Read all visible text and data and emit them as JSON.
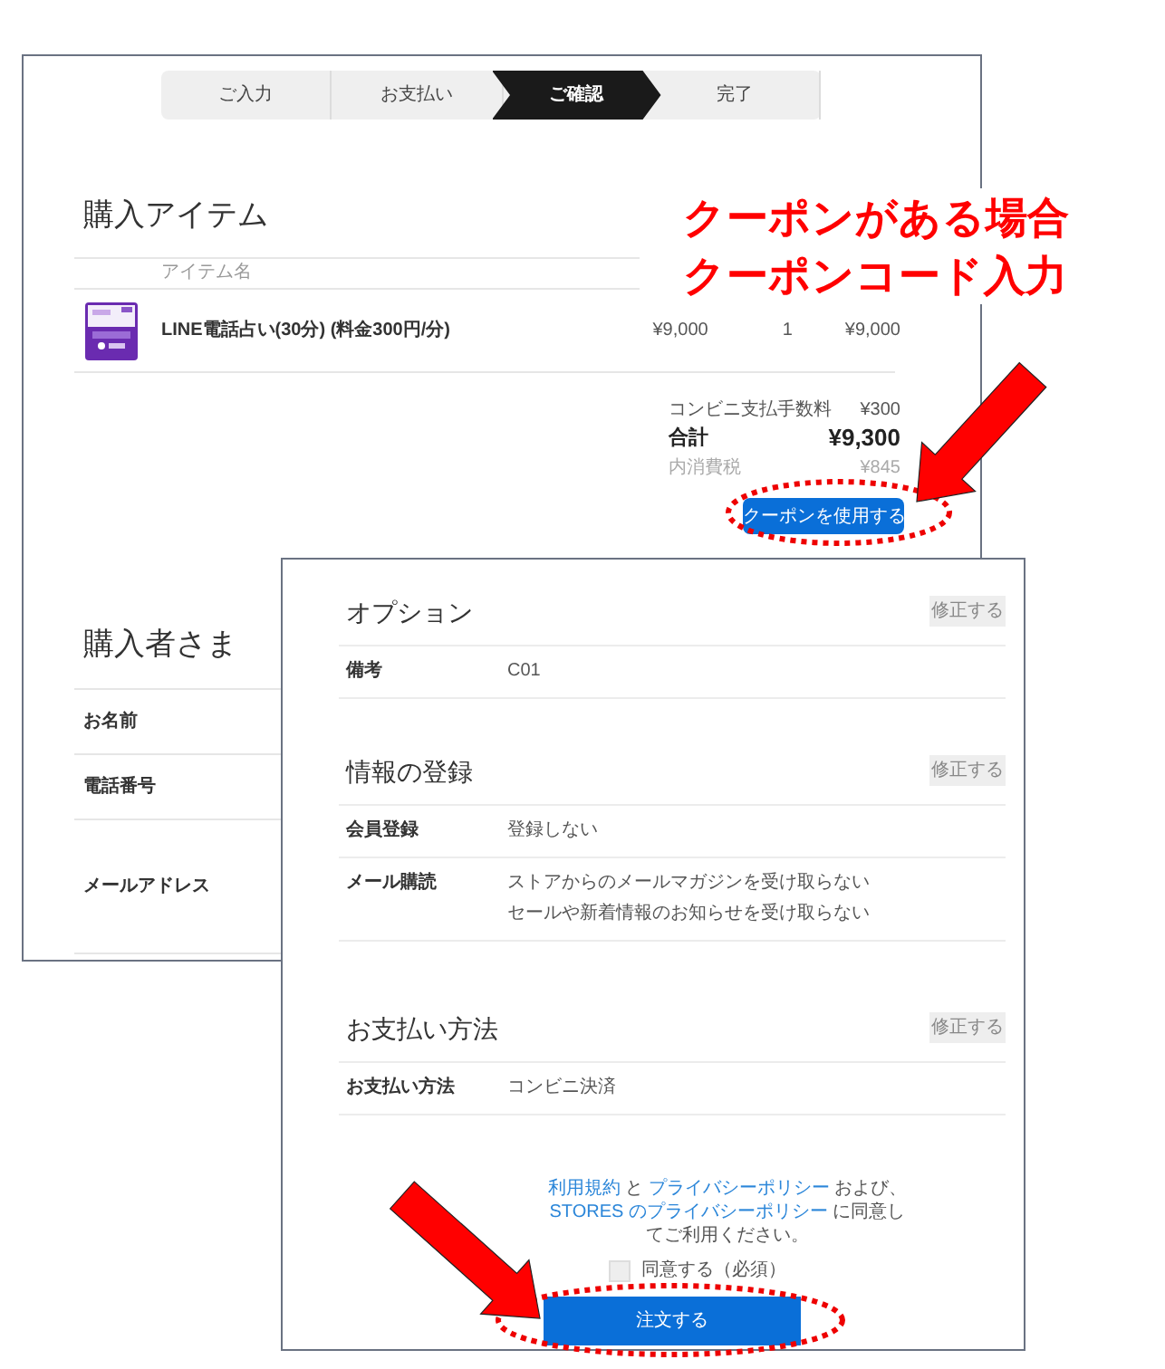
{
  "back_page": {
    "steps": [
      {
        "label": "ご入力",
        "selected": false
      },
      {
        "label": "お支払い",
        "selected": false
      },
      {
        "label": "ご確認",
        "selected": true
      },
      {
        "label": "完了",
        "selected": false
      }
    ],
    "items_section": {
      "title": "購入アイテム",
      "column": "アイテム名",
      "items": [
        {
          "name": "LINE電話占い(30分) (料金300円/分)",
          "price": "¥9,000",
          "quantity": "1",
          "total": "¥9,000"
        }
      ]
    },
    "summary": [
      {
        "kind": "fee",
        "label": "コンビニ支払手数料",
        "value": "¥300"
      },
      {
        "kind": "total",
        "label": "合計",
        "value": "¥9,300"
      },
      {
        "kind": "tax",
        "label": "内消費税",
        "value": "¥845"
      }
    ],
    "coupon_button": "クーポンを使用する",
    "buyer_section": {
      "title": "購入者さま",
      "rows": [
        "お名前",
        "電話番号",
        "メールアドレス"
      ]
    }
  },
  "front_page": {
    "sections": [
      {
        "title": "オプション",
        "edit": "修正する",
        "rows": [
          {
            "label": "備考",
            "values": [
              "C01"
            ]
          }
        ]
      },
      {
        "title": "情報の登録",
        "edit": "修正する",
        "rows": [
          {
            "label": "会員登録",
            "values": [
              "登録しない"
            ]
          },
          {
            "label": "メール購読",
            "values": [
              "ストアからのメールマガジンを受け取らない",
              "セールや新着情報のお知らせを受け取らない"
            ]
          }
        ]
      },
      {
        "title": "お支払い方法",
        "edit": "修正する",
        "rows": [
          {
            "label": "お支払い方法",
            "values": [
              "コンビニ決済"
            ]
          }
        ]
      }
    ],
    "consent": [
      {
        "text": "利用規約",
        "link": true
      },
      {
        "text": " と ",
        "link": false
      },
      {
        "text": "プライバシーポリシー",
        "link": true
      },
      {
        "text": " および、",
        "link": false
      },
      {
        "text": "STORES のプライバシーポリシー",
        "link": true
      },
      {
        "text": " に同意してご利用ください。",
        "link": false
      }
    ],
    "agree": {
      "label": "同意する（必須）",
      "checked": false
    },
    "order_button": "注文する"
  },
  "callout": [
    "クーポンがある場合",
    "クーポンコード入力"
  ]
}
